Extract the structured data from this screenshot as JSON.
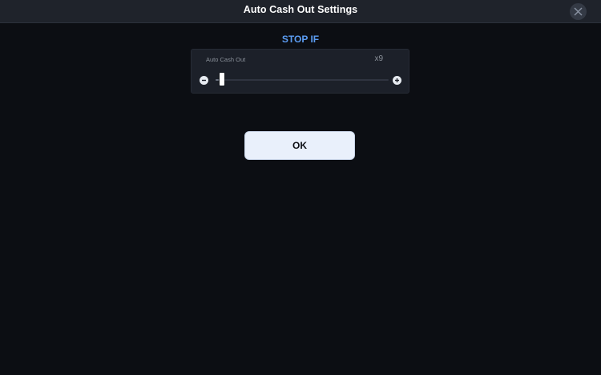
{
  "dialog": {
    "title": "Auto Cash Out Settings"
  },
  "section": {
    "heading": "STOP IF"
  },
  "auto_cash_out": {
    "label": "Auto Cash Out",
    "value_display": "x9",
    "slider_fraction": 0.02
  },
  "ok_button": {
    "label": "OK"
  },
  "colors": {
    "background": "#0c0e13",
    "header": "#1f232b",
    "accent": "#5b9cf2",
    "card": "#1c2029",
    "button": "#e9f0fb"
  },
  "icons": {
    "close": "close-icon",
    "minus": "minus-icon",
    "plus": "plus-icon"
  }
}
